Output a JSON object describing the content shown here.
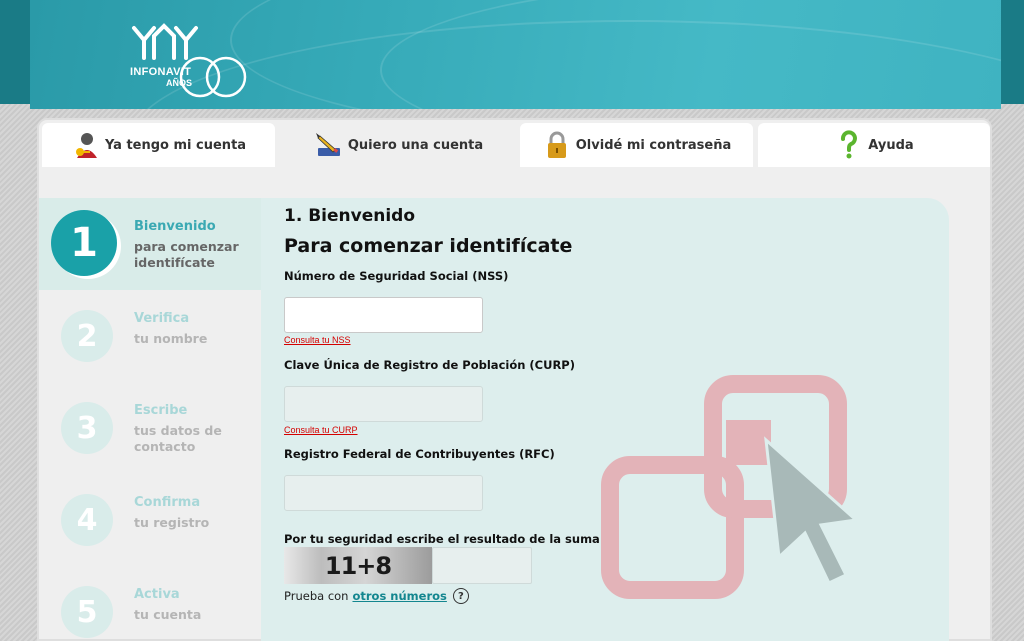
{
  "brand": {
    "name": "INFONAVIT",
    "years_label": "AÑOS"
  },
  "tabs": [
    {
      "label": "Ya tengo mi cuenta",
      "icon": "user-key-icon",
      "active": false
    },
    {
      "label": "Quiero una cuenta",
      "icon": "pencil-icon",
      "active": true
    },
    {
      "label": "Olvidé mi contraseña",
      "icon": "lock-icon",
      "active": false
    },
    {
      "label": "Ayuda",
      "icon": "question-icon",
      "active": false
    }
  ],
  "steps": [
    {
      "number": "1",
      "title": "Bienvenido",
      "desc": "para comenzar identifícate",
      "active": true
    },
    {
      "number": "2",
      "title": "Verifica",
      "desc": "tu nombre",
      "active": false
    },
    {
      "number": "3",
      "title": "Escribe",
      "desc": "tus datos de contacto",
      "active": false
    },
    {
      "number": "4",
      "title": "Confirma",
      "desc": "tu registro",
      "active": false
    },
    {
      "number": "5",
      "title": "Activa",
      "desc": "tu cuenta",
      "active": false
    }
  ],
  "form": {
    "heading": "1. Bienvenido",
    "subheading": "Para comenzar identifícate",
    "nss": {
      "label": "Número de Seguridad Social (NSS)",
      "value": "",
      "hint": "Consulta tu NSS"
    },
    "curp": {
      "label": "Clave Única de Registro de Población (CURP)",
      "value": "",
      "hint": "Consulta tu CURP"
    },
    "rfc": {
      "label": "Registro Federal de Contribuyentes (RFC)",
      "value": ""
    },
    "captcha": {
      "label": "Por tu seguridad escribe el resultado de la suma",
      "expression": "11+8",
      "value": "",
      "refresh_prefix": "Prueba con",
      "refresh_link": "otros números",
      "help_glyph": "?"
    }
  },
  "colors": {
    "accent": "#1aa1a8",
    "banner": "#36aab8",
    "link_red": "#d40000",
    "watermark": "#e3b3b8"
  }
}
